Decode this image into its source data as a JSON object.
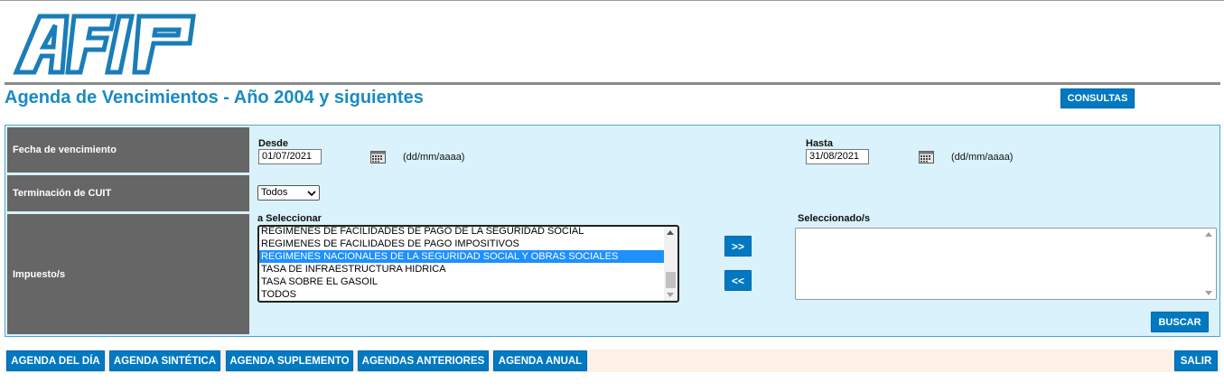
{
  "header": {
    "logo_text": "AFIP",
    "page_title": "Agenda de Vencimientos - Año 2004 y siguientes",
    "consultas_label": "CONSULTAS"
  },
  "form": {
    "fecha": {
      "label": "Fecha de vencimiento",
      "desde_label": "Desde",
      "desde_value": "01/07/2021",
      "hasta_label": "Hasta",
      "hasta_value": "31/08/2021",
      "format_hint": "(dd/mm/aaaa)"
    },
    "cuit": {
      "label": "Terminación de CUIT",
      "selected": "Todos"
    },
    "impuesto": {
      "label": "Impuesto/s",
      "available_label": "a Seleccionar",
      "selected_label": "Seleccionado/s",
      "available_items": [
        "REGIMENES DE FACILIDADES DE PAGO DE LA SEGURIDAD SOCIAL",
        "REGIMENES DE FACILIDADES DE PAGO IMPOSITIVOS",
        "REGIMENES NACIONALES DE LA SEGURIDAD SOCIAL Y OBRAS SOCIALES",
        "TASA DE INFRAESTRUCTURA HIDRICA",
        "TASA SOBRE EL GASOIL",
        "TODOS"
      ],
      "selected_items": [],
      "add_label": ">>",
      "remove_label": "<<"
    },
    "buscar_label": "BUSCAR"
  },
  "nav": {
    "agenda_del_dia": "AGENDA DEL DÍA",
    "agenda_sintetica": "AGENDA SINTÉTICA",
    "agenda_suplemento": "AGENDA SUPLEMENTO",
    "agendas_anteriores": "AGENDAS ANTERIORES",
    "agenda_anual": "AGENDA ANUAL",
    "salir": "SALIR"
  },
  "colors": {
    "brand_blue": "#0079c1",
    "title_blue": "#1a8bc0",
    "panel_bg": "#d9f2fb",
    "label_bg": "#666666",
    "selected_item": "#1e90ff"
  }
}
